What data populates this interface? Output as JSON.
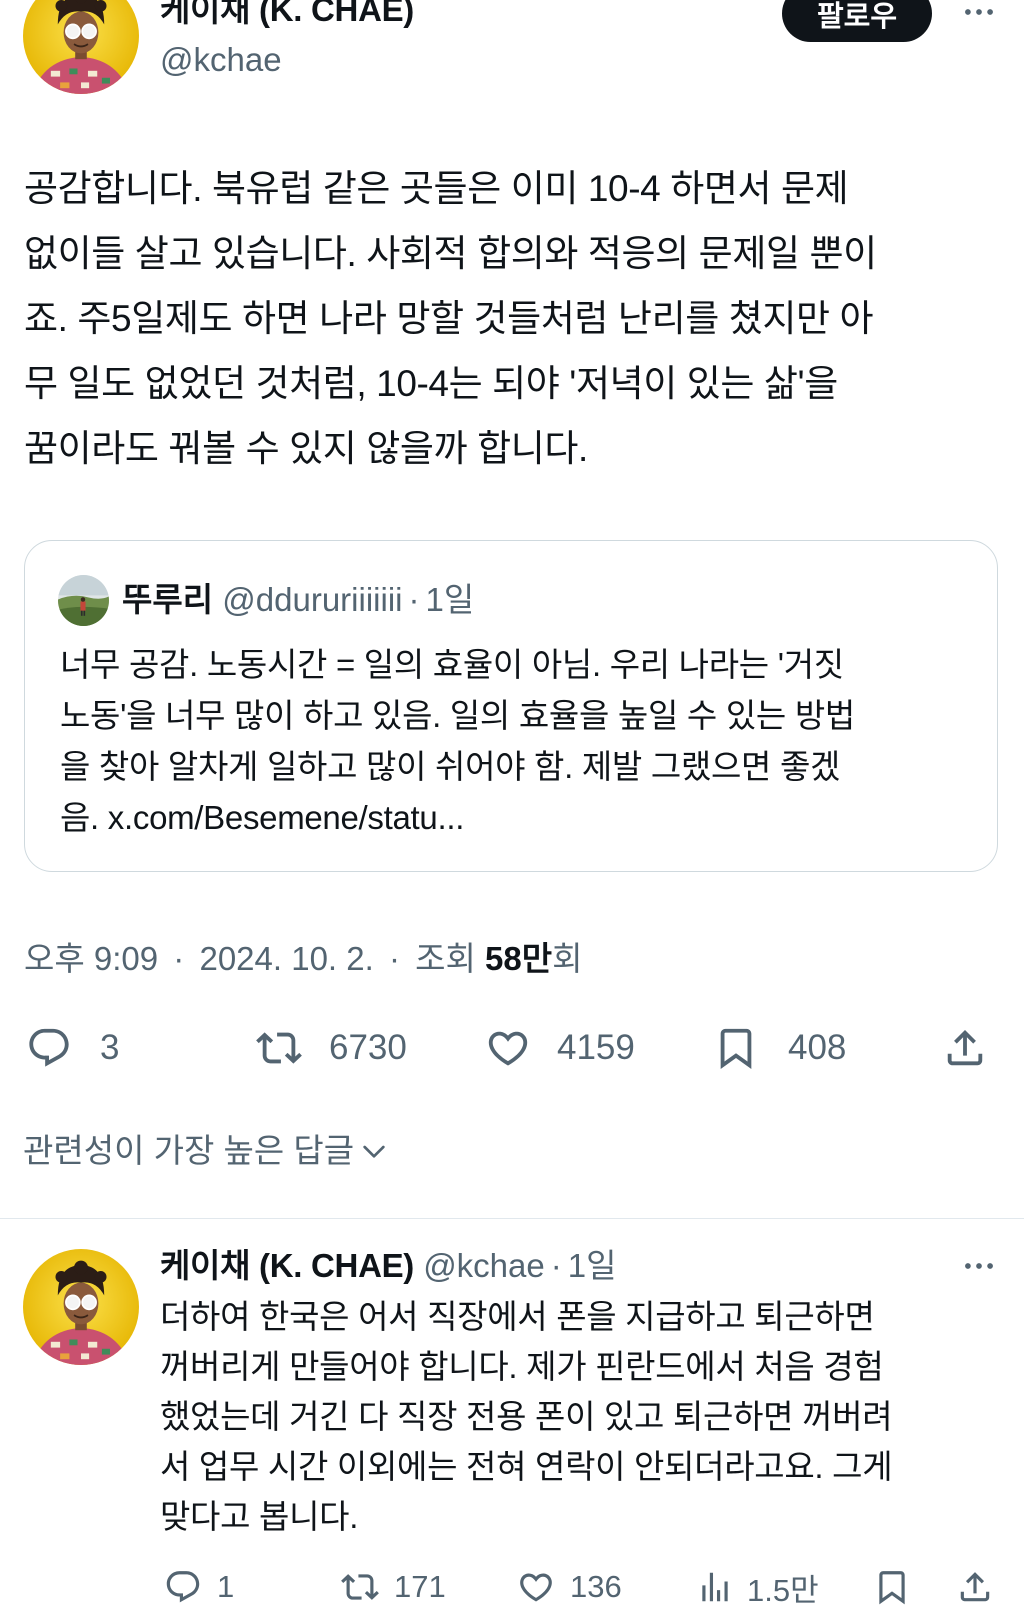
{
  "colors": {
    "text": "#0f1419",
    "secondary": "#536471",
    "border": "#cfd9de",
    "follow_button_bg": "#0f1419",
    "follow_button_text": "#ffffff",
    "avatar_bg": "#f2c400"
  },
  "main_tweet": {
    "author": {
      "name": "케이채 (K. CHAE)",
      "handle": "@kchae",
      "avatar_icon": "avatar"
    },
    "follow_label": "팔로우",
    "more_icon": "more-icon",
    "text_lines": [
      "공감합니다. 북유럽 같은 곳들은 이미 10-4 하면서 문제",
      "없이들 살고 있습니다. 사회적 합의와 적응의 문제일 뿐이",
      "죠. 주5일제도 하면 나라 망할 것들처럼 난리를 쳤지만 아",
      "무 일도 없었던 것처럼, 10-4는 되야 '저녁이 있는 삶'을",
      "꿈이라도 꿔볼 수 있지 않을까 합니다."
    ],
    "quote": {
      "name": "뚜루리",
      "handle": "@ddururiiiiiii",
      "separator": "·",
      "time": "1일",
      "text_lines": [
        "너무 공감. 노동시간 = 일의 효율이 아님. 우리 나라는 '거짓",
        "노동'을 너무 많이 하고 있음. 일의 효율을 높일 수 있는 방법",
        "을 찾아 알차게 일하고 많이 쉬어야 함. 제발 그랬으면 좋겠",
        "음. x.com/Besemene/statu..."
      ]
    },
    "meta": {
      "time": "오후 9:09",
      "separator": "·",
      "date": "2024. 10. 2.",
      "views_label": "조회",
      "views_count": "58만",
      "views_suffix": "회"
    },
    "actions": [
      {
        "icon": "reply-icon",
        "count": "3"
      },
      {
        "icon": "retweet-icon",
        "count": "6730"
      },
      {
        "icon": "heart-icon",
        "count": "4159"
      },
      {
        "icon": "bookmark-icon",
        "count": "408"
      },
      {
        "icon": "share-icon"
      }
    ]
  },
  "replies_sort": {
    "label": "관련성이 가장 높은 답글",
    "icon": "chevron-down-icon"
  },
  "reply": {
    "author": {
      "name": "케이채 (K. CHAE)",
      "handle": "@kchae"
    },
    "separator": "·",
    "time": "1일",
    "more_icon": "more-icon",
    "text_lines": [
      "더하여 한국은 어서 직장에서 폰을 지급하고 퇴근하면",
      "꺼버리게 만들어야 합니다. 제가 핀란드에서 처음 경험",
      "했었는데 거긴 다 직장 전용 폰이 있고 퇴근하면 꺼버려",
      "서 업무 시간 이외에는 전혀 연락이 안되더라고요. 그게",
      "맞다고 봅니다."
    ],
    "actions": [
      {
        "icon": "reply-icon",
        "count": "1"
      },
      {
        "icon": "retweet-icon",
        "count": "171"
      },
      {
        "icon": "heart-icon",
        "count": "136"
      },
      {
        "icon": "views-icon",
        "count": "1.5만"
      },
      {
        "icon": "bookmark-icon"
      },
      {
        "icon": "share-icon"
      }
    ]
  }
}
